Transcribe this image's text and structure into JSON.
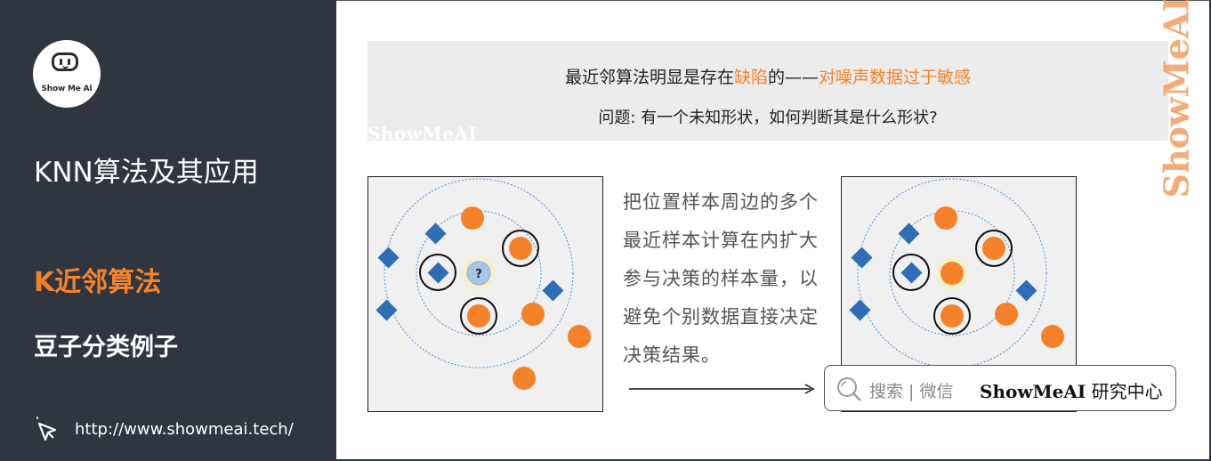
{
  "sidebar": {
    "logo_text": "Show Me AI",
    "title": "KNN算法及其应用",
    "subtitle1": "K近邻算法",
    "subtitle2": "豆子分类例子",
    "url": "http://www.showmeai.tech/"
  },
  "banner": {
    "line1_a": "最近邻算法明显是存在",
    "line1_b": "缺陷",
    "line1_c": "的——",
    "line1_d": "对噪声数据过于敏感",
    "line2": "问题: 有一个未知形状，如何判断其是什么形状?"
  },
  "watermark": {
    "small": "ShowMeAI",
    "vertical": "ShowMeAI"
  },
  "diagram": {
    "unknown_label": "?",
    "description": "把位置样本周边的多个最近样本计算在内扩大参与决策的样本量，以避免个别数据直接决定决策结果。"
  },
  "search": {
    "label": "搜索 | 微信",
    "brand": "ShowMeAI",
    "suffix": "研究中心"
  },
  "colors": {
    "sidebar": "#2f3640",
    "accent": "#f5822a",
    "diamond": "#2f6db5",
    "circle": "#f5822a",
    "unknown": "#a9c4e8"
  },
  "icons": [
    "robot-logo-icon",
    "cursor-click-icon",
    "search-icon",
    "arrow-right-icon"
  ]
}
